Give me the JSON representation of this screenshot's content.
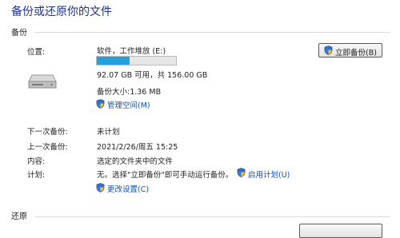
{
  "page_title": "备份或还原你的文件",
  "backup": {
    "section_label": "备份",
    "location_label": "位置:",
    "drive_name": "软件，工作堆放 (E:)",
    "usage_fraction": 0.41,
    "space_text": "92.07 GB 可用，共 156.00 GB",
    "backup_size": "备份大小:1.36 MB",
    "manage_space_link": "管理空间(M)",
    "backup_now_button": "立即备份(B)",
    "next_backup_label": "下一次备份:",
    "next_backup_value": "未计划",
    "last_backup_label": "上一次备份:",
    "last_backup_value": "2021/2/26/周五 15:25",
    "contents_label": "内容:",
    "contents_value": "选定的文件夹中的文件",
    "schedule_label": "计划:",
    "schedule_value": "无。选择\"立即备份\"即可手动运行备份。",
    "enable_schedule_link": "启用计划(U)",
    "change_settings_link": "更改设置(C)"
  },
  "restore": {
    "section_label": "还原"
  },
  "colors": {
    "title": "#1e3287",
    "link": "#0a50b4",
    "progress_fill": "#26a0da"
  },
  "icons": [
    "drive-icon",
    "shield-icon"
  ]
}
